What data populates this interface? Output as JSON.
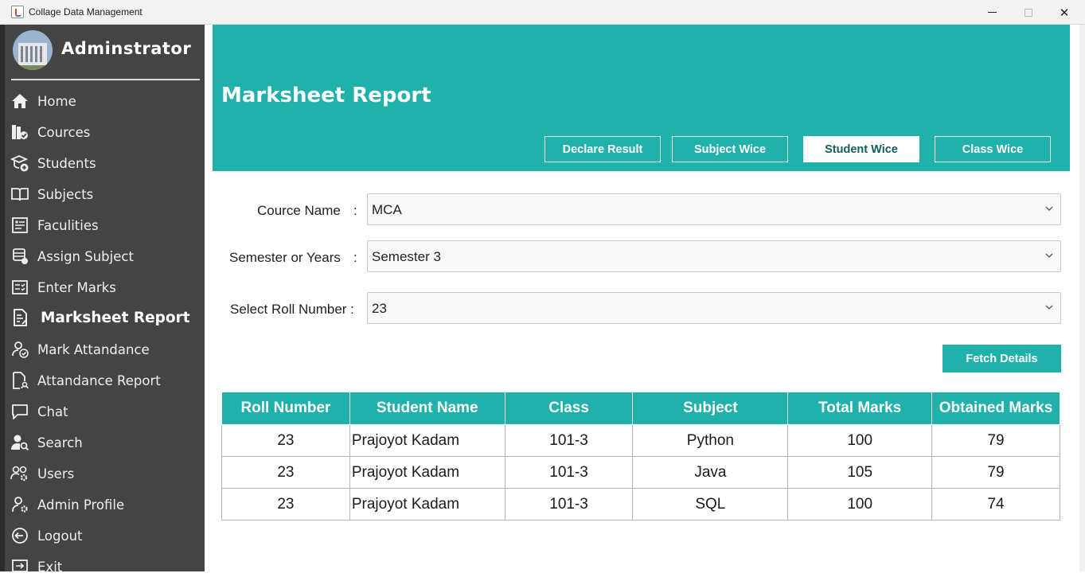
{
  "window": {
    "title": "Collage Data Management",
    "minimize": "—",
    "close": "✕"
  },
  "sidebar": {
    "admin_name": "Adminstrator",
    "items": [
      {
        "label": "Home",
        "icon": "home-icon"
      },
      {
        "label": "Cources",
        "icon": "books-icon"
      },
      {
        "label": "Students",
        "icon": "student-add-icon"
      },
      {
        "label": "Subjects",
        "icon": "book-open-icon"
      },
      {
        "label": "Faculities",
        "icon": "id-card-icon"
      },
      {
        "label": "Assign Subject",
        "icon": "assign-icon"
      },
      {
        "label": "Enter Marks",
        "icon": "checklist-icon"
      },
      {
        "label": "Marksheet Report",
        "icon": "report-icon",
        "active": true
      },
      {
        "label": "Mark Attandance",
        "icon": "user-check-icon"
      },
      {
        "label": "Attandance Report",
        "icon": "document-user-icon"
      },
      {
        "label": "Chat",
        "icon": "chat-icon"
      },
      {
        "label": "Search",
        "icon": "user-search-icon"
      },
      {
        "label": "Users",
        "icon": "users-settings-icon"
      },
      {
        "label": "Admin Profile",
        "icon": "user-gear-icon"
      },
      {
        "label": "Logout",
        "icon": "logout-icon"
      },
      {
        "label": "Exit",
        "icon": "exit-icon"
      }
    ]
  },
  "header": {
    "title": "Marksheet Report",
    "buttons": [
      "Declare Result",
      "Subject Wice",
      "Student Wice",
      "Class Wice"
    ],
    "selected": "Student Wice"
  },
  "form": {
    "course_label": "Cource Name",
    "course_colon": ":",
    "course_value": "MCA",
    "semester_label": "Semester or Years",
    "semester_colon": ":",
    "semester_value": "Semester 3",
    "roll_label": "Select Roll Number :",
    "roll_value": "23",
    "fetch_label": "Fetch Details"
  },
  "table": {
    "headers": [
      "Roll Number",
      "Student Name",
      "Class",
      "Subject",
      "Total Marks",
      "Obtained Marks"
    ],
    "rows": [
      [
        "23",
        "Prajoyot Kadam",
        "101-3",
        "Python",
        "100",
        "79"
      ],
      [
        "23",
        "Prajoyot Kadam",
        "101-3",
        "Java",
        "105",
        "79"
      ],
      [
        "23",
        "Prajoyot Kadam",
        "101-3",
        "SQL",
        "100",
        "74"
      ]
    ]
  },
  "colors": {
    "accent": "#20b2aa",
    "sidebar": "#444444"
  }
}
